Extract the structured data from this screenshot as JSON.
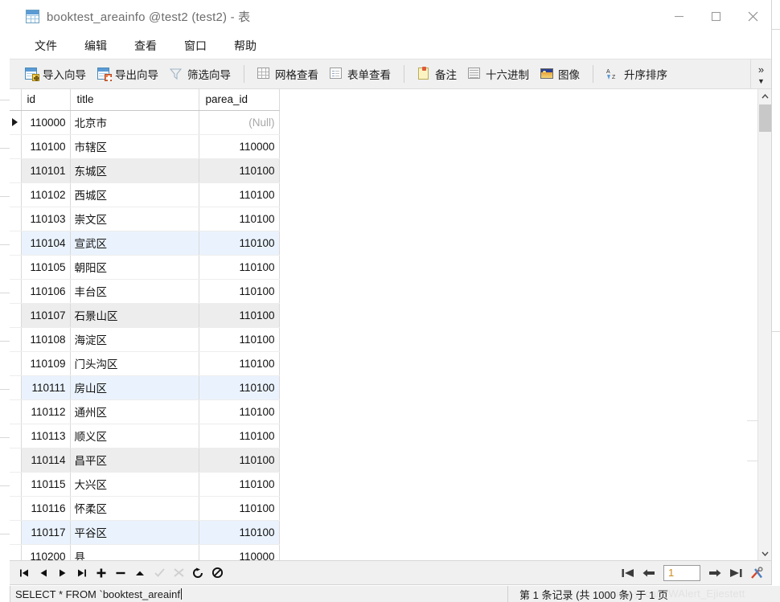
{
  "window": {
    "title": "booktest_areainfo @test2 (test2) - 表",
    "icon": "table-icon",
    "minimize_label": "—",
    "maximize_label": "□",
    "close_label": "✕"
  },
  "menubar": {
    "items": [
      {
        "label": "文件",
        "name": "menu-file"
      },
      {
        "label": "编辑",
        "name": "menu-edit"
      },
      {
        "label": "查看",
        "name": "menu-view"
      },
      {
        "label": "窗口",
        "name": "menu-window"
      },
      {
        "label": "帮助",
        "name": "menu-help"
      }
    ]
  },
  "toolbar": {
    "import_wizard": "导入向导",
    "export_wizard": "导出向导",
    "filter_wizard": "筛选向导",
    "grid_view": "网格查看",
    "form_view": "表单查看",
    "memo": "备注",
    "hex": "十六进制",
    "image": "图像",
    "sort_asc": "升序排序",
    "overflow": "»"
  },
  "grid": {
    "columns": [
      "id",
      "title",
      "parea_id"
    ],
    "active_column": "id",
    "null_label": "(Null)",
    "rows": [
      {
        "id": "110000",
        "title": "北京市",
        "parea_id": "(Null)",
        "is_null": true,
        "stripe": "none",
        "current": true
      },
      {
        "id": "110100",
        "title": "市辖区",
        "parea_id": "110000",
        "is_null": false,
        "stripe": "none",
        "current": false
      },
      {
        "id": "110101",
        "title": "东城区",
        "parea_id": "110100",
        "is_null": false,
        "stripe": "gray",
        "current": false
      },
      {
        "id": "110102",
        "title": "西城区",
        "parea_id": "110100",
        "is_null": false,
        "stripe": "none",
        "current": false
      },
      {
        "id": "110103",
        "title": "崇文区",
        "parea_id": "110100",
        "is_null": false,
        "stripe": "none",
        "current": false
      },
      {
        "id": "110104",
        "title": "宣武区",
        "parea_id": "110100",
        "is_null": false,
        "stripe": "blue",
        "current": false
      },
      {
        "id": "110105",
        "title": "朝阳区",
        "parea_id": "110100",
        "is_null": false,
        "stripe": "none",
        "current": false
      },
      {
        "id": "110106",
        "title": "丰台区",
        "parea_id": "110100",
        "is_null": false,
        "stripe": "none",
        "current": false
      },
      {
        "id": "110107",
        "title": "石景山区",
        "parea_id": "110100",
        "is_null": false,
        "stripe": "gray",
        "current": false
      },
      {
        "id": "110108",
        "title": "海淀区",
        "parea_id": "110100",
        "is_null": false,
        "stripe": "none",
        "current": false
      },
      {
        "id": "110109",
        "title": "门头沟区",
        "parea_id": "110100",
        "is_null": false,
        "stripe": "none",
        "current": false
      },
      {
        "id": "110111",
        "title": "房山区",
        "parea_id": "110100",
        "is_null": false,
        "stripe": "blue",
        "current": false
      },
      {
        "id": "110112",
        "title": "通州区",
        "parea_id": "110100",
        "is_null": false,
        "stripe": "none",
        "current": false
      },
      {
        "id": "110113",
        "title": "顺义区",
        "parea_id": "110100",
        "is_null": false,
        "stripe": "none",
        "current": false
      },
      {
        "id": "110114",
        "title": "昌平区",
        "parea_id": "110100",
        "is_null": false,
        "stripe": "gray",
        "current": false
      },
      {
        "id": "110115",
        "title": "大兴区",
        "parea_id": "110100",
        "is_null": false,
        "stripe": "none",
        "current": false
      },
      {
        "id": "110116",
        "title": "怀柔区",
        "parea_id": "110100",
        "is_null": false,
        "stripe": "none",
        "current": false
      },
      {
        "id": "110117",
        "title": "平谷区",
        "parea_id": "110100",
        "is_null": false,
        "stripe": "blue",
        "current": false
      },
      {
        "id": "110200",
        "title": "县",
        "parea_id": "110000",
        "is_null": false,
        "stripe": "none",
        "current": false
      }
    ]
  },
  "record_nav": {
    "buttons": [
      {
        "name": "first-record-button",
        "glyph": "|◀",
        "disabled": false
      },
      {
        "name": "prev-record-button",
        "glyph": "◀",
        "disabled": false
      },
      {
        "name": "next-record-button",
        "glyph": "▶",
        "disabled": false
      },
      {
        "name": "last-record-button",
        "glyph": "▶|",
        "disabled": false
      },
      {
        "name": "add-record-button",
        "glyph": "✛",
        "disabled": false
      },
      {
        "name": "delete-record-button",
        "glyph": "—",
        "disabled": false
      },
      {
        "name": "apply-up-button",
        "glyph": "▲",
        "disabled": false
      },
      {
        "name": "confirm-edit-button",
        "glyph": "✓",
        "disabled": true
      },
      {
        "name": "cancel-edit-button",
        "glyph": "✕",
        "disabled": true
      },
      {
        "name": "refresh-button",
        "glyph": "↻",
        "disabled": false
      },
      {
        "name": "stop-button",
        "glyph": "⊘",
        "disabled": false
      }
    ],
    "page_first": "|◀",
    "page_prev": "◀",
    "page_value": "1",
    "page_next": "▶",
    "page_last": "▶|",
    "tools": "tools-icon"
  },
  "statusbar": {
    "query": "SELECT * FROM `booktest_areainf",
    "record_info": "第 1 条记录 (共 1000 条) 于 1 页",
    "watermark": "...pottring-y. cam/WAlert_Ejiestett"
  }
}
